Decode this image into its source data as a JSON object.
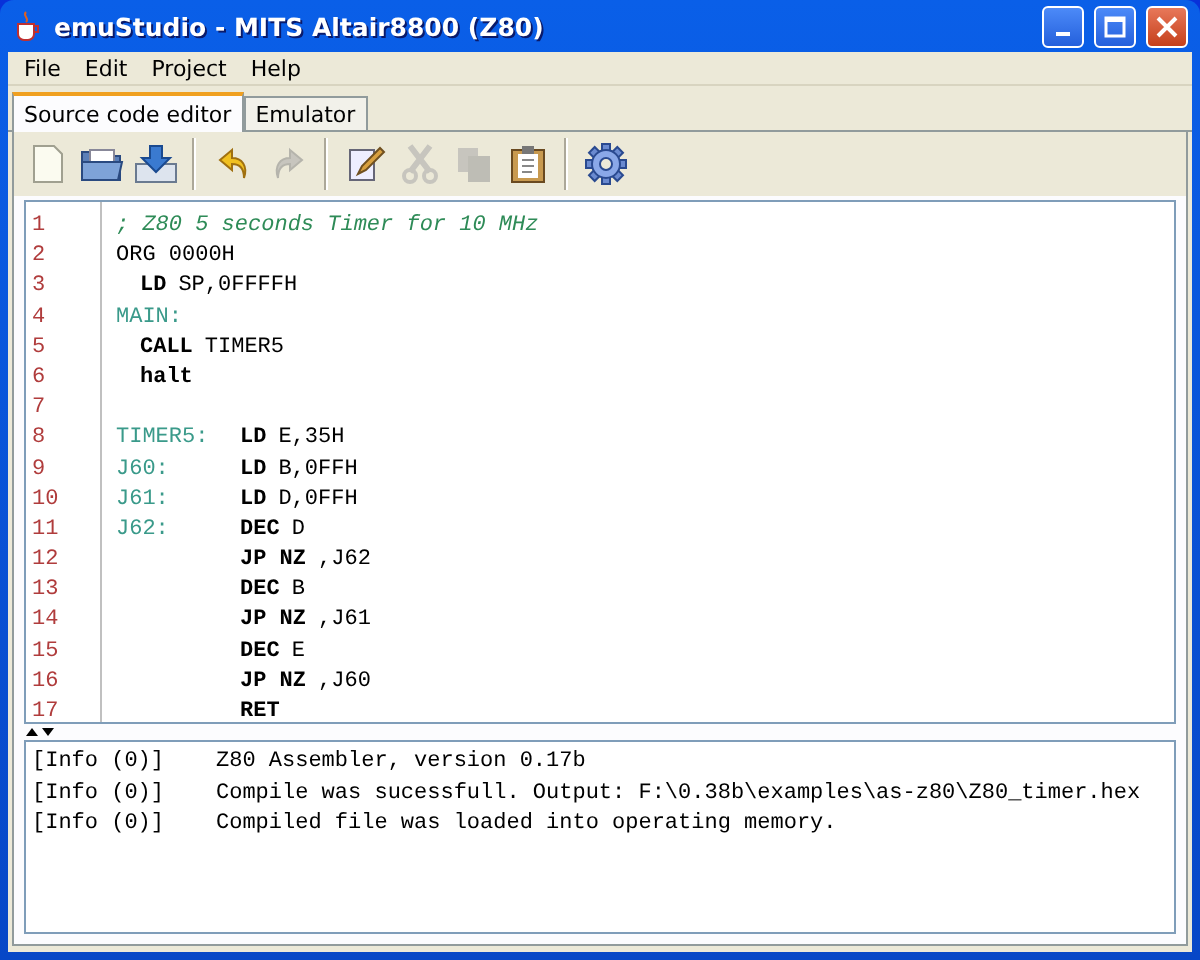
{
  "window": {
    "title": "emuStudio - MITS Altair8800 (Z80)"
  },
  "menu": [
    "File",
    "Edit",
    "Project",
    "Help"
  ],
  "tabs": [
    {
      "label": "Source code editor",
      "selected": true
    },
    {
      "label": "Emulator",
      "selected": false
    }
  ],
  "toolbar": [
    {
      "kind": "new",
      "disabled": false
    },
    {
      "kind": "open",
      "disabled": false
    },
    {
      "kind": "save",
      "disabled": false
    },
    {
      "kind": "sep"
    },
    {
      "kind": "undo",
      "disabled": false
    },
    {
      "kind": "redo",
      "disabled": true
    },
    {
      "kind": "sep"
    },
    {
      "kind": "edit",
      "disabled": false
    },
    {
      "kind": "cut",
      "disabled": true
    },
    {
      "kind": "copy",
      "disabled": true
    },
    {
      "kind": "paste",
      "disabled": false
    },
    {
      "kind": "sep"
    },
    {
      "kind": "settings",
      "disabled": false
    }
  ],
  "editor": {
    "lines": [
      {
        "number": "1",
        "kind": "plain",
        "segments": [
          {
            "kind": "comment",
            "text": "; Z80 5 seconds Timer for 10 MHz"
          }
        ]
      },
      {
        "number": "2",
        "kind": "plain",
        "segments": [
          {
            "kind": "directive",
            "text": "ORG 0000H"
          }
        ]
      },
      {
        "number": "3",
        "kind": "indented",
        "segments": [
          {
            "kind": "keyword",
            "text": "LD"
          },
          {
            "kind": "operand",
            "text": "SP,0FFFFH"
          }
        ]
      },
      {
        "number": "4",
        "kind": "plain",
        "segments": [
          {
            "kind": "label",
            "text": "MAIN:"
          }
        ]
      },
      {
        "number": "5",
        "kind": "indented",
        "segments": [
          {
            "kind": "keyword",
            "text": "CALL"
          },
          {
            "kind": "operand",
            "text": "TIMER5"
          }
        ]
      },
      {
        "number": "6",
        "kind": "indented",
        "segments": [
          {
            "kind": "keyword",
            "text": "halt"
          }
        ]
      },
      {
        "number": "7",
        "kind": "plain"
      },
      {
        "number": "8",
        "kind": "tabbed",
        "label": "TIMER5:",
        "segments": [
          {
            "kind": "keyword",
            "text": "LD"
          },
          {
            "kind": "operand",
            "text": "E,35H"
          }
        ]
      },
      {
        "number": "9",
        "kind": "tabbed",
        "label": "J60:",
        "segments": [
          {
            "kind": "keyword",
            "text": "LD"
          },
          {
            "kind": "operand",
            "text": "B,0FFH"
          }
        ]
      },
      {
        "number": "10",
        "kind": "tabbed",
        "label": "J61:",
        "segments": [
          {
            "kind": "keyword",
            "text": "LD"
          },
          {
            "kind": "operand",
            "text": "D,0FFH"
          }
        ]
      },
      {
        "number": "11",
        "kind": "tabbed",
        "label": "J62:",
        "segments": [
          {
            "kind": "keyword",
            "text": "DEC"
          },
          {
            "kind": "operand",
            "text": "D"
          }
        ]
      },
      {
        "number": "12",
        "kind": "tabbed",
        "segments": [
          {
            "kind": "keyword",
            "text": "JP NZ"
          },
          {
            "kind": "operand",
            "text": ",J62"
          }
        ]
      },
      {
        "number": "13",
        "kind": "tabbed",
        "segments": [
          {
            "kind": "keyword",
            "text": "DEC"
          },
          {
            "kind": "operand",
            "text": "B"
          }
        ]
      },
      {
        "number": "14",
        "kind": "tabbed",
        "segments": [
          {
            "kind": "keyword",
            "text": "JP NZ"
          },
          {
            "kind": "operand",
            "text": ",J61"
          }
        ]
      },
      {
        "number": "15",
        "kind": "tabbed",
        "segments": [
          {
            "kind": "keyword",
            "text": "DEC"
          },
          {
            "kind": "operand",
            "text": "E"
          }
        ]
      },
      {
        "number": "16",
        "kind": "tabbed",
        "segments": [
          {
            "kind": "keyword",
            "text": "JP NZ"
          },
          {
            "kind": "operand",
            "text": ",J60"
          }
        ]
      },
      {
        "number": "17",
        "kind": "tabbed",
        "segments": [
          {
            "kind": "keyword",
            "text": "RET"
          }
        ]
      }
    ]
  },
  "output": [
    {
      "source": "[Info (0)]",
      "message": "Z80 Assembler, version 0.17b"
    },
    {
      "source": "[Info (0)]",
      "message": "Compile was sucessfull. Output: F:\\0.38b\\examples\\as-z80\\Z80_timer.hex"
    },
    {
      "source": "[Info (0)]",
      "message": "Compiled file was loaded into operating memory."
    }
  ]
}
